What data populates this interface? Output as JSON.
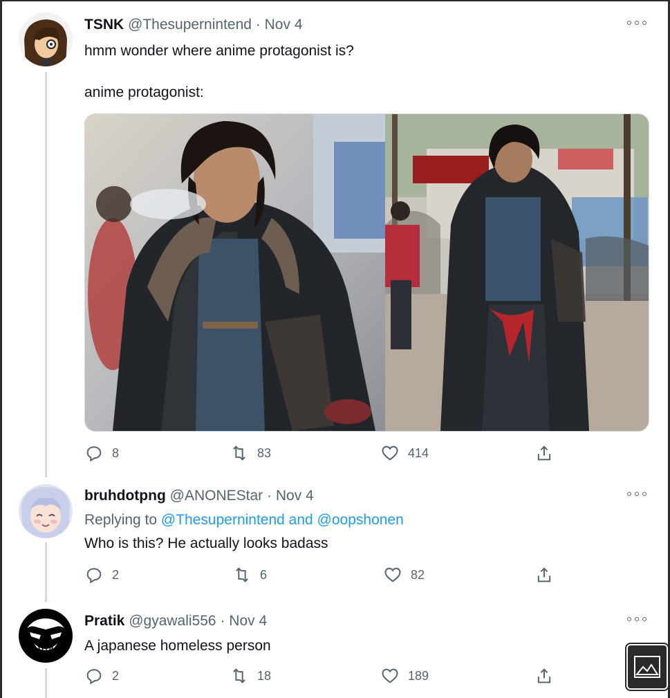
{
  "tweets": [
    {
      "name": "TSNK",
      "handle": "@Thesupernintend",
      "dot": "·",
      "date": "Nov 4",
      "text_line1": "hmm wonder where anime protagonist is?",
      "text_line2": "anime protagonist:",
      "replies": "8",
      "retweets": "83",
      "likes": "414"
    },
    {
      "name": "bruhdotpng",
      "handle": "@ANONEStar",
      "dot": "·",
      "date": "Nov 4",
      "replying_prefix": "Replying to ",
      "replying_users": "@Thesupernintend and @oopshonen",
      "text": "Who is this? He actually looks badass",
      "replies": "2",
      "retweets": "6",
      "likes": "82"
    },
    {
      "name": "Pratik",
      "handle": "@gyawali556",
      "dot": "·",
      "date": "Nov 4",
      "text": "A japanese homeless person",
      "replies": "2",
      "retweets": "18",
      "likes": "189"
    }
  ],
  "icons": {
    "reply": "reply-icon",
    "retweet": "retweet-icon",
    "like": "heart-icon",
    "share": "share-icon",
    "more": "more-icon",
    "image": "image-icon"
  },
  "colors": {
    "link": "#1d9bf0",
    "secondary": "#536471",
    "thread_line": "#cfd9de"
  }
}
